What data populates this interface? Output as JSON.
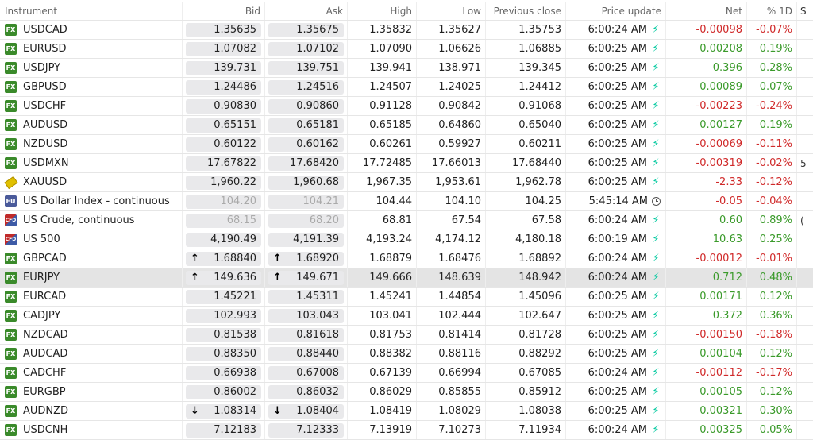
{
  "header": {
    "instrument": "Instrument",
    "bid": "Bid",
    "ask": "Ask",
    "high": "High",
    "low": "Low",
    "prev_close": "Previous close",
    "price_update": "Price update",
    "net": "Net",
    "pct_1d": "% 1D",
    "extra": "S"
  },
  "rows": [
    {
      "badge": "FX",
      "name": "USDCAD",
      "bid": "1.35635",
      "ask": "1.35675",
      "high": "1.35832",
      "low": "1.35627",
      "prev": "1.35753",
      "time": "6:00:24 AM",
      "status": "bolt",
      "net": "-0.00098",
      "pct": "-0.07%",
      "dir": "neg"
    },
    {
      "badge": "FX",
      "name": "EURUSD",
      "bid": "1.07082",
      "ask": "1.07102",
      "high": "1.07090",
      "low": "1.06626",
      "prev": "1.06885",
      "time": "6:00:25 AM",
      "status": "bolt",
      "net": "0.00208",
      "pct": "0.19%",
      "dir": "pos"
    },
    {
      "badge": "FX",
      "name": "USDJPY",
      "bid": "139.731",
      "ask": "139.751",
      "high": "139.941",
      "low": "138.971",
      "prev": "139.345",
      "time": "6:00:25 AM",
      "status": "bolt",
      "net": "0.396",
      "pct": "0.28%",
      "dir": "pos"
    },
    {
      "badge": "FX",
      "name": "GBPUSD",
      "bid": "1.24486",
      "ask": "1.24516",
      "high": "1.24507",
      "low": "1.24025",
      "prev": "1.24412",
      "time": "6:00:25 AM",
      "status": "bolt",
      "net": "0.00089",
      "pct": "0.07%",
      "dir": "pos"
    },
    {
      "badge": "FX",
      "name": "USDCHF",
      "bid": "0.90830",
      "ask": "0.90860",
      "high": "0.91128",
      "low": "0.90842",
      "prev": "0.91068",
      "time": "6:00:25 AM",
      "status": "bolt",
      "net": "-0.00223",
      "pct": "-0.24%",
      "dir": "neg"
    },
    {
      "badge": "FX",
      "name": "AUDUSD",
      "bid": "0.65151",
      "ask": "0.65181",
      "high": "0.65185",
      "low": "0.64860",
      "prev": "0.65040",
      "time": "6:00:25 AM",
      "status": "bolt",
      "net": "0.00127",
      "pct": "0.19%",
      "dir": "pos"
    },
    {
      "badge": "FX",
      "name": "NZDUSD",
      "bid": "0.60122",
      "ask": "0.60162",
      "high": "0.60261",
      "low": "0.59927",
      "prev": "0.60211",
      "time": "6:00:25 AM",
      "status": "bolt",
      "net": "-0.00069",
      "pct": "-0.11%",
      "dir": "neg"
    },
    {
      "badge": "FX",
      "name": "USDMXN",
      "bid": "17.67822",
      "ask": "17.68420",
      "high": "17.72485",
      "low": "17.66013",
      "prev": "17.68440",
      "time": "6:00:25 AM",
      "status": "bolt",
      "net": "-0.00319",
      "pct": "-0.02%",
      "dir": "neg",
      "extra": "5"
    },
    {
      "badge": "GOLD",
      "name": "XAUUSD",
      "bid": "1,960.22",
      "ask": "1,960.68",
      "high": "1,967.35",
      "low": "1,953.61",
      "prev": "1,962.78",
      "time": "6:00:25 AM",
      "status": "bolt",
      "net": "-2.33",
      "pct": "-0.12%",
      "dir": "neg"
    },
    {
      "badge": "FU",
      "name": "US Dollar Index - continuous",
      "bid": "104.20",
      "ask": "104.21",
      "high": "104.44",
      "low": "104.10",
      "prev": "104.25",
      "time": "5:45:14 AM",
      "status": "clock",
      "net": "-0.05",
      "pct": "-0.04%",
      "dir": "neg",
      "muted": true
    },
    {
      "badge": "CFD",
      "name": "US Crude, continuous",
      "bid": "68.15",
      "ask": "68.20",
      "high": "68.81",
      "low": "67.54",
      "prev": "67.58",
      "time": "6:00:24 AM",
      "status": "bolt",
      "net": "0.60",
      "pct": "0.89%",
      "dir": "pos",
      "muted": true,
      "extra": "("
    },
    {
      "badge": "CFD",
      "name": "US 500",
      "bid": "4,190.49",
      "ask": "4,191.39",
      "high": "4,193.24",
      "low": "4,174.12",
      "prev": "4,180.18",
      "time": "6:00:19 AM",
      "status": "bolt",
      "net": "10.63",
      "pct": "0.25%",
      "dir": "pos"
    },
    {
      "badge": "FX",
      "name": "GBPCAD",
      "bid": "1.68840",
      "ask": "1.68920",
      "high": "1.68879",
      "low": "1.68476",
      "prev": "1.68892",
      "time": "6:00:24 AM",
      "status": "bolt",
      "net": "-0.00012",
      "pct": "-0.01%",
      "dir": "neg",
      "arrow": "up"
    },
    {
      "badge": "FX",
      "name": "EURJPY",
      "bid": "149.636",
      "ask": "149.671",
      "high": "149.666",
      "low": "148.639",
      "prev": "148.942",
      "time": "6:00:24 AM",
      "status": "bolt",
      "net": "0.712",
      "pct": "0.48%",
      "dir": "pos",
      "arrow": "up",
      "selected": true
    },
    {
      "badge": "FX",
      "name": "EURCAD",
      "bid": "1.45221",
      "ask": "1.45311",
      "high": "1.45241",
      "low": "1.44854",
      "prev": "1.45096",
      "time": "6:00:25 AM",
      "status": "bolt",
      "net": "0.00171",
      "pct": "0.12%",
      "dir": "pos"
    },
    {
      "badge": "FX",
      "name": "CADJPY",
      "bid": "102.993",
      "ask": "103.043",
      "high": "103.041",
      "low": "102.444",
      "prev": "102.647",
      "time": "6:00:25 AM",
      "status": "bolt",
      "net": "0.372",
      "pct": "0.36%",
      "dir": "pos"
    },
    {
      "badge": "FX",
      "name": "NZDCAD",
      "bid": "0.81538",
      "ask": "0.81618",
      "high": "0.81753",
      "low": "0.81414",
      "prev": "0.81728",
      "time": "6:00:25 AM",
      "status": "bolt",
      "net": "-0.00150",
      "pct": "-0.18%",
      "dir": "neg"
    },
    {
      "badge": "FX",
      "name": "AUDCAD",
      "bid": "0.88350",
      "ask": "0.88440",
      "high": "0.88382",
      "low": "0.88116",
      "prev": "0.88292",
      "time": "6:00:25 AM",
      "status": "bolt",
      "net": "0.00104",
      "pct": "0.12%",
      "dir": "pos"
    },
    {
      "badge": "FX",
      "name": "CADCHF",
      "bid": "0.66938",
      "ask": "0.67008",
      "high": "0.67139",
      "low": "0.66994",
      "prev": "0.67085",
      "time": "6:00:24 AM",
      "status": "bolt",
      "net": "-0.00112",
      "pct": "-0.17%",
      "dir": "neg"
    },
    {
      "badge": "FX",
      "name": "EURGBP",
      "bid": "0.86002",
      "ask": "0.86032",
      "high": "0.86029",
      "low": "0.85855",
      "prev": "0.85912",
      "time": "6:00:25 AM",
      "status": "bolt",
      "net": "0.00105",
      "pct": "0.12%",
      "dir": "pos"
    },
    {
      "badge": "FX",
      "name": "AUDNZD",
      "bid": "1.08314",
      "ask": "1.08404",
      "high": "1.08419",
      "low": "1.08029",
      "prev": "1.08038",
      "time": "6:00:25 AM",
      "status": "bolt",
      "net": "0.00321",
      "pct": "0.30%",
      "dir": "pos",
      "arrow": "down"
    },
    {
      "badge": "FX",
      "name": "USDCNH",
      "bid": "7.12183",
      "ask": "7.12333",
      "high": "7.13919",
      "low": "7.10273",
      "prev": "7.11934",
      "time": "6:00:24 AM",
      "status": "bolt",
      "net": "0.00325",
      "pct": "0.05%",
      "dir": "pos"
    }
  ],
  "colors": {
    "positive": "#3a9a2a",
    "negative": "#d02a2a",
    "fx_badge": "#3a8a2a"
  }
}
